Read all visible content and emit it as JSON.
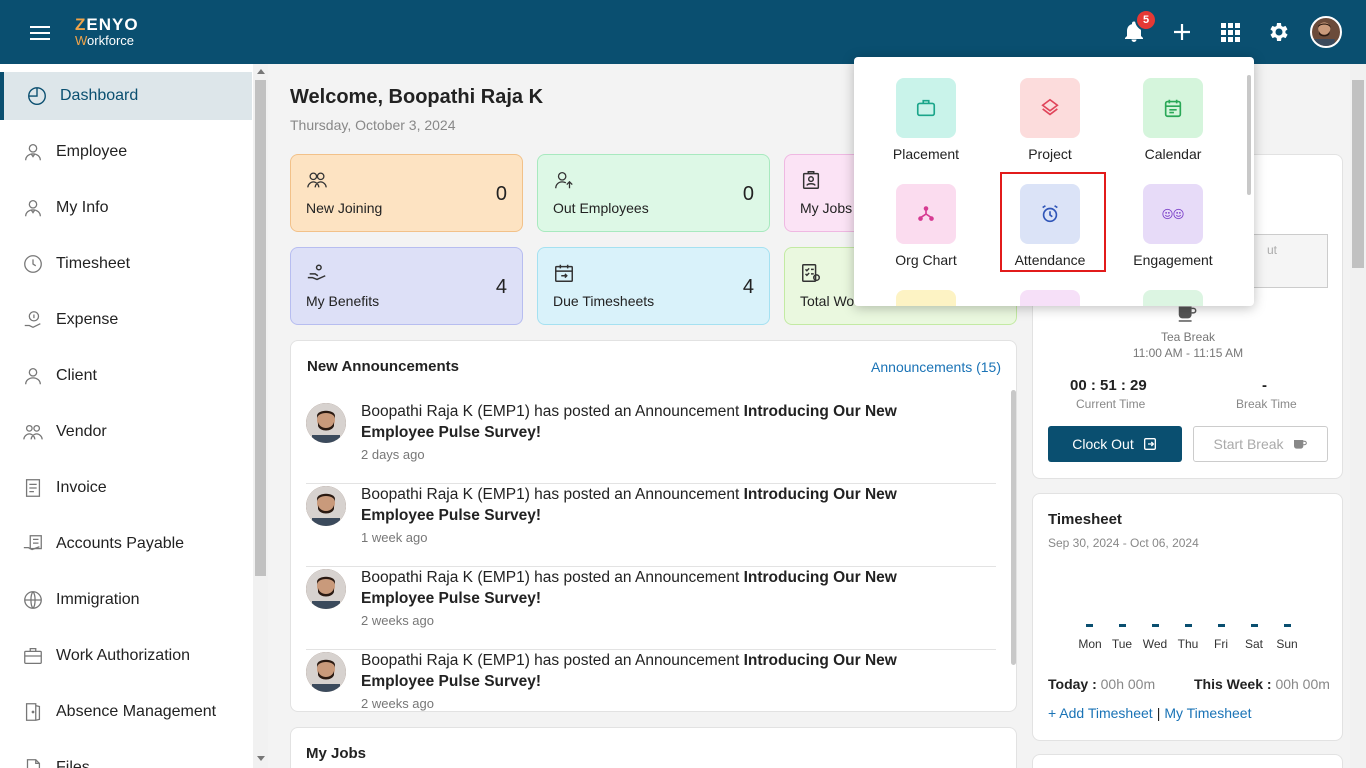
{
  "header": {
    "logo_main_first": "Z",
    "logo_main_rest": "ENYO",
    "logo_sub_first": "W",
    "logo_sub_rest": "orkforce",
    "notification_count": "5"
  },
  "sidebar": {
    "items": [
      {
        "label": "Dashboard",
        "icon": "dashboard-icon"
      },
      {
        "label": "Employee",
        "icon": "employee-icon"
      },
      {
        "label": "My Info",
        "icon": "my-info-icon"
      },
      {
        "label": "Timesheet",
        "icon": "clock-icon"
      },
      {
        "label": "Expense",
        "icon": "expense-icon"
      },
      {
        "label": "Client",
        "icon": "client-icon"
      },
      {
        "label": "Vendor",
        "icon": "vendor-icon"
      },
      {
        "label": "Invoice",
        "icon": "invoice-icon"
      },
      {
        "label": "Accounts Payable",
        "icon": "accounts-payable-icon"
      },
      {
        "label": "Immigration",
        "icon": "globe-icon"
      },
      {
        "label": "Work Authorization",
        "icon": "briefcase-icon"
      },
      {
        "label": "Absence Management",
        "icon": "door-icon"
      },
      {
        "label": "Files",
        "icon": "file-icon"
      }
    ]
  },
  "main": {
    "welcome": "Welcome, Boopathi Raja K",
    "date": "Thursday, October 3, 2024",
    "cards": [
      {
        "label": "New Joining",
        "value": "0"
      },
      {
        "label": "Out Employees",
        "value": "0"
      },
      {
        "label": "My Jobs",
        "value": ""
      },
      {
        "label": "My Benefits",
        "value": "4"
      },
      {
        "label": "Due Timesheets",
        "value": "4"
      },
      {
        "label": "Total Wo",
        "value": ""
      }
    ],
    "announcements": {
      "title": "New Announcements",
      "link": "Announcements (15)",
      "items": [
        {
          "prefix": "Boopathi Raja K (EMP1) has posted an Announcement ",
          "headline": "Introducing Our New Employee Pulse Survey!",
          "time": "2 days ago"
        },
        {
          "prefix": "Boopathi Raja K (EMP1) has posted an Announcement ",
          "headline": "Introducing Our New Employee Pulse Survey!",
          "time": "1 week ago"
        },
        {
          "prefix": "Boopathi Raja K (EMP1) has posted an Announcement ",
          "headline": "Introducing Our New Employee Pulse Survey!",
          "time": "2 weeks ago"
        },
        {
          "prefix": "Boopathi Raja K (EMP1) has posted an Announcement ",
          "headline": "Introducing Our New Employee Pulse Survey!",
          "time": "2 weeks ago"
        }
      ]
    },
    "my_jobs_title": "My Jobs"
  },
  "attendance": {
    "clock_box_text": "ut",
    "tea_break": "Tea Break",
    "tea_break_time": "11:00 AM - 11:15 AM",
    "current_time": "00 : 51 : 29",
    "current_time_label": "Current Time",
    "break_time": "-",
    "break_time_label": "Break Time",
    "clock_out_label": "Clock Out",
    "start_break_label": "Start Break"
  },
  "timesheet": {
    "title": "Timesheet",
    "range": "Sep 30, 2024 - Oct 06, 2024",
    "days": [
      "Mon",
      "Tue",
      "Wed",
      "Thu",
      "Fri",
      "Sat",
      "Sun"
    ],
    "today_label": "Today :",
    "today_value": "00h 00m",
    "week_label": "This Week :",
    "week_value": "00h 00m",
    "add_link": "+ Add Timesheet",
    "sep": "|",
    "my_link": "My Timesheet"
  },
  "launcher": {
    "apps": [
      {
        "label": "Placement",
        "bg": "#c9f3ea",
        "fg": "#1aa58a"
      },
      {
        "label": "Project",
        "bg": "#fcdcdc",
        "fg": "#e0455b"
      },
      {
        "label": "Calendar",
        "bg": "#d5f5dc",
        "fg": "#2aa857"
      },
      {
        "label": "Org Chart",
        "bg": "#fbdcef",
        "fg": "#d63a92"
      },
      {
        "label": "Attendance",
        "bg": "#dbe3f7",
        "fg": "#2f55b8"
      },
      {
        "label": "Engagement",
        "bg": "#e7dbf8",
        "fg": "#7a3fc8"
      }
    ]
  },
  "colors": {
    "primary": "#0a4f70",
    "accent": "#f0a44a",
    "link": "#1a73b6",
    "highlight": "#e21b1b"
  }
}
